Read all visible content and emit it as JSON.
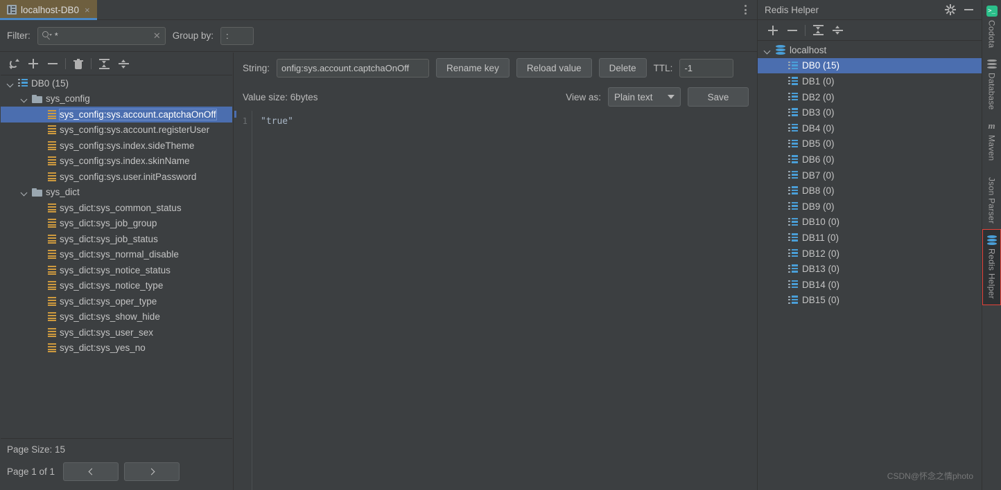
{
  "tab": {
    "title": "localhost-DB0",
    "close_label": "×",
    "icon": "database-table-icon",
    "menu_icon": "more-vertical-icon"
  },
  "filter_bar": {
    "filter_label": "Filter:",
    "filter_value": "*",
    "filter_clear_label": "✕",
    "search_icon": "search-icon",
    "group_by_label": "Group by:",
    "group_by_value": ":"
  },
  "tree_toolbar": {
    "buttons": [
      {
        "name": "refresh-button",
        "icon": "refresh-icon"
      },
      {
        "name": "add-key-button",
        "icon": "plus-icon"
      },
      {
        "name": "remove-key-button",
        "icon": "minus-icon"
      },
      {
        "name": "delete-button",
        "icon": "trash-icon"
      },
      {
        "name": "expand-all-button",
        "icon": "expand-all-icon"
      },
      {
        "name": "collapse-all-button",
        "icon": "collapse-all-icon"
      }
    ]
  },
  "key_tree": {
    "root": {
      "label": "DB0 (15)",
      "icon": "database-list-icon"
    },
    "groups": [
      {
        "label": "sys_config",
        "icon": "folder-icon",
        "keys": [
          "sys_config:sys.account.captchaOnOff",
          "sys_config:sys.account.registerUser",
          "sys_config:sys.index.sideTheme",
          "sys_config:sys.index.skinName",
          "sys_config:sys.user.initPassword"
        ]
      },
      {
        "label": "sys_dict",
        "icon": "folder-icon",
        "keys": [
          "sys_dict:sys_common_status",
          "sys_dict:sys_job_group",
          "sys_dict:sys_job_status",
          "sys_dict:sys_normal_disable",
          "sys_dict:sys_notice_status",
          "sys_dict:sys_notice_type",
          "sys_dict:sys_oper_type",
          "sys_dict:sys_show_hide",
          "sys_dict:sys_user_sex",
          "sys_dict:sys_yes_no"
        ]
      }
    ],
    "selected_key": "sys_config:sys.account.captchaOnOff"
  },
  "pager": {
    "page_size_label": "Page Size: 15",
    "page_label": "Page 1 of 1",
    "prev_label": "‹",
    "next_label": "›"
  },
  "detail": {
    "type_label": "String:",
    "key_value": "onfig:sys.account.captchaOnOff",
    "rename_key_label": "Rename key",
    "reload_value_label": "Reload value",
    "delete_label": "Delete",
    "ttl_label": "TTL:",
    "ttl_value": "-1",
    "value_size_label": "Value size: 6bytes",
    "view_as_label": "View as:",
    "view_as_value": "Plain text",
    "save_label": "Save",
    "editor_line_number": "1",
    "editor_content": "\"true\""
  },
  "redis_helper": {
    "title": "Redis Helper",
    "settings_icon": "gear-icon",
    "minimize_icon": "minimize-icon",
    "toolbar": [
      {
        "name": "add-connection-button",
        "icon": "plus-icon"
      },
      {
        "name": "remove-connection-button",
        "icon": "minus-icon"
      },
      {
        "name": "expand-all-button",
        "icon": "expand-all-icon"
      },
      {
        "name": "collapse-all-button",
        "icon": "collapse-all-icon"
      }
    ],
    "server": {
      "label": "localhost",
      "icon": "server-stack-icon"
    },
    "databases": [
      {
        "label": "DB0 (15)",
        "selected": true
      },
      {
        "label": "DB1 (0)",
        "selected": false
      },
      {
        "label": "DB2 (0)",
        "selected": false
      },
      {
        "label": "DB3 (0)",
        "selected": false
      },
      {
        "label": "DB4 (0)",
        "selected": false
      },
      {
        "label": "DB5 (0)",
        "selected": false
      },
      {
        "label": "DB6 (0)",
        "selected": false
      },
      {
        "label": "DB7 (0)",
        "selected": false
      },
      {
        "label": "DB8 (0)",
        "selected": false
      },
      {
        "label": "DB9 (0)",
        "selected": false
      },
      {
        "label": "DB10 (0)",
        "selected": false
      },
      {
        "label": "DB11 (0)",
        "selected": false
      },
      {
        "label": "DB12 (0)",
        "selected": false
      },
      {
        "label": "DB13 (0)",
        "selected": false
      },
      {
        "label": "DB14 (0)",
        "selected": false
      },
      {
        "label": "DB15 (0)",
        "selected": false
      }
    ]
  },
  "tool_strip": {
    "tabs": [
      {
        "label": "Codota",
        "icon": "codota-icon",
        "active": false
      },
      {
        "label": "Database",
        "icon": "database-stack-icon",
        "active": false
      },
      {
        "label": "Maven",
        "icon": "maven-icon",
        "active": false
      },
      {
        "label": "Json Parser",
        "icon": "json-parser-icon",
        "active": false
      },
      {
        "label": "Redis Helper",
        "icon": "redis-stack-icon",
        "active": true
      }
    ]
  },
  "watermark": {
    "text": "CSDN@怀念之情photo"
  },
  "colors": {
    "background": "#3c3f41",
    "selection_blue": "#4b6eaf",
    "tab_active": "#6e5f3f",
    "tab_underline": "#4a88c7",
    "key_icon_amber": "#cf9b3f",
    "db_icon_blue": "#4a9fd8",
    "active_strip_border": "#e8433a",
    "codota_green": "#2bbf8a"
  }
}
